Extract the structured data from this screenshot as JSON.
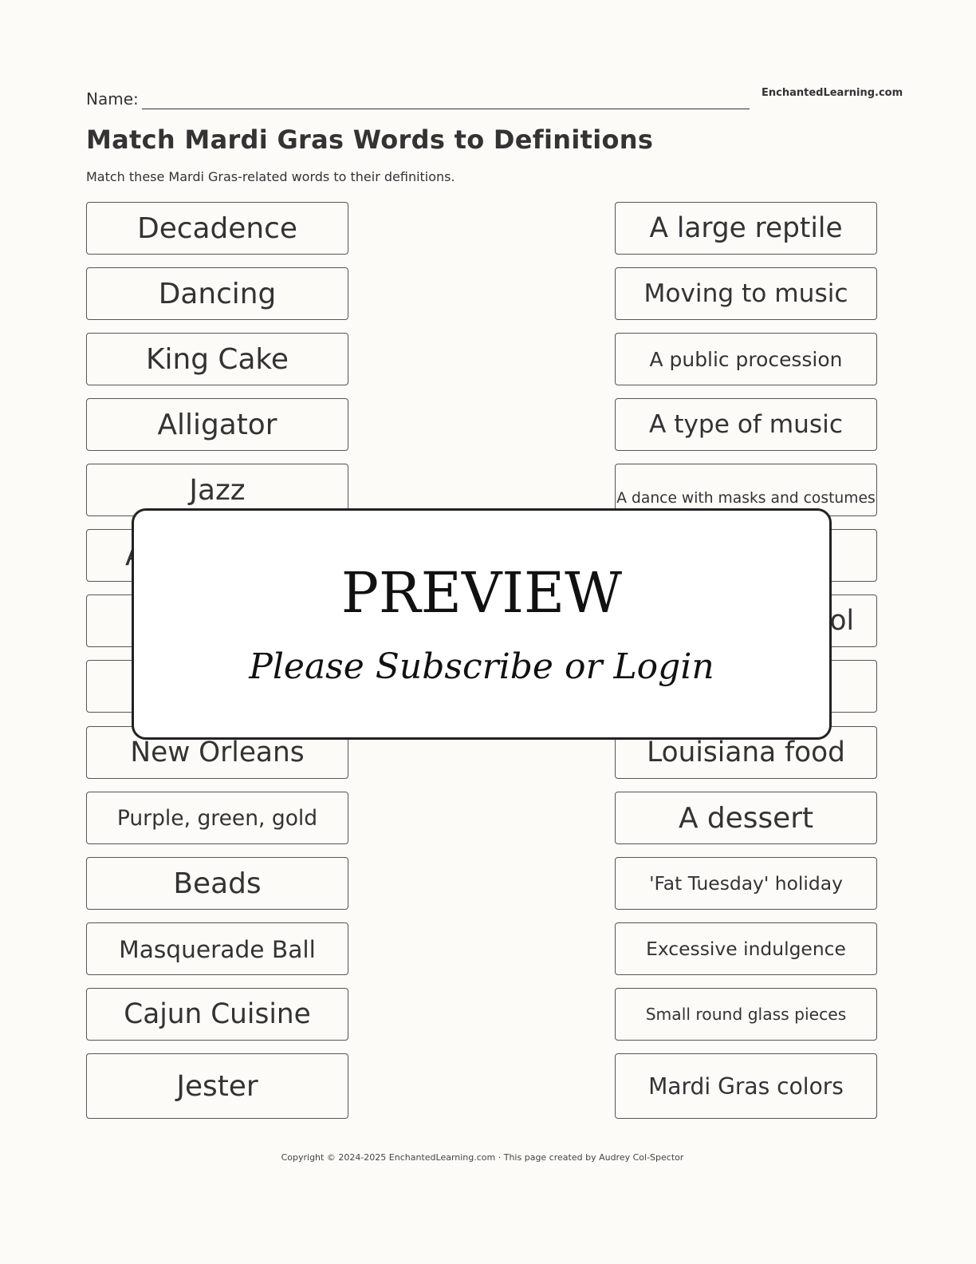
{
  "header": {
    "name_label": "Name:",
    "brand": "EnchantedLearning.com",
    "title": "Match Mardi Gras Words to Definitions",
    "subtitle": "Match these Mardi Gras-related words to their definitions."
  },
  "words": [
    {
      "text": "Decadence",
      "size": 46
    },
    {
      "text": "Dancing",
      "size": 46
    },
    {
      "text": "King Cake",
      "size": 46
    },
    {
      "text": "Alligator",
      "size": 46
    },
    {
      "text": "Jazz",
      "size": 46
    },
    {
      "text": "A",
      "size": 46,
      "align": "left"
    },
    {
      "text": "",
      "size": 46
    },
    {
      "text": "",
      "size": 46
    },
    {
      "text": "New Orleans",
      "size": 44
    },
    {
      "text": "Purple, green, gold",
      "size": 34
    },
    {
      "text": "Beads",
      "size": 46
    },
    {
      "text": "Masquerade Ball",
      "size": 38
    },
    {
      "text": "Cajun Cuisine",
      "size": 44
    },
    {
      "text": "Jester",
      "size": 46
    }
  ],
  "definitions": [
    {
      "text": "A large reptile",
      "size": 44
    },
    {
      "text": "Moving to music",
      "size": 40
    },
    {
      "text": "A public procession",
      "size": 32
    },
    {
      "text": "A type of music",
      "size": 40
    },
    {
      "text": "A dance with masks and costumes",
      "size": 24,
      "wrap": true
    },
    {
      "text": "",
      "size": 40
    },
    {
      "text": "ol",
      "size": 44,
      "align": "right"
    },
    {
      "text": "",
      "size": 40
    },
    {
      "text": "Louisiana food",
      "size": 44
    },
    {
      "text": "A dessert",
      "size": 46
    },
    {
      "text": "'Fat Tuesday' holiday",
      "size": 30
    },
    {
      "text": "Excessive indulgence",
      "size": 30
    },
    {
      "text": "Small round glass pieces",
      "size": 26
    },
    {
      "text": "Mardi Gras colors",
      "size": 36
    }
  ],
  "overlay": {
    "title": "PREVIEW",
    "subtitle": "Please Subscribe or Login"
  },
  "footer": {
    "text": "Copyright © 2024-2025 EnchantedLearning.com · This page created by Audrey Col-Spector"
  }
}
